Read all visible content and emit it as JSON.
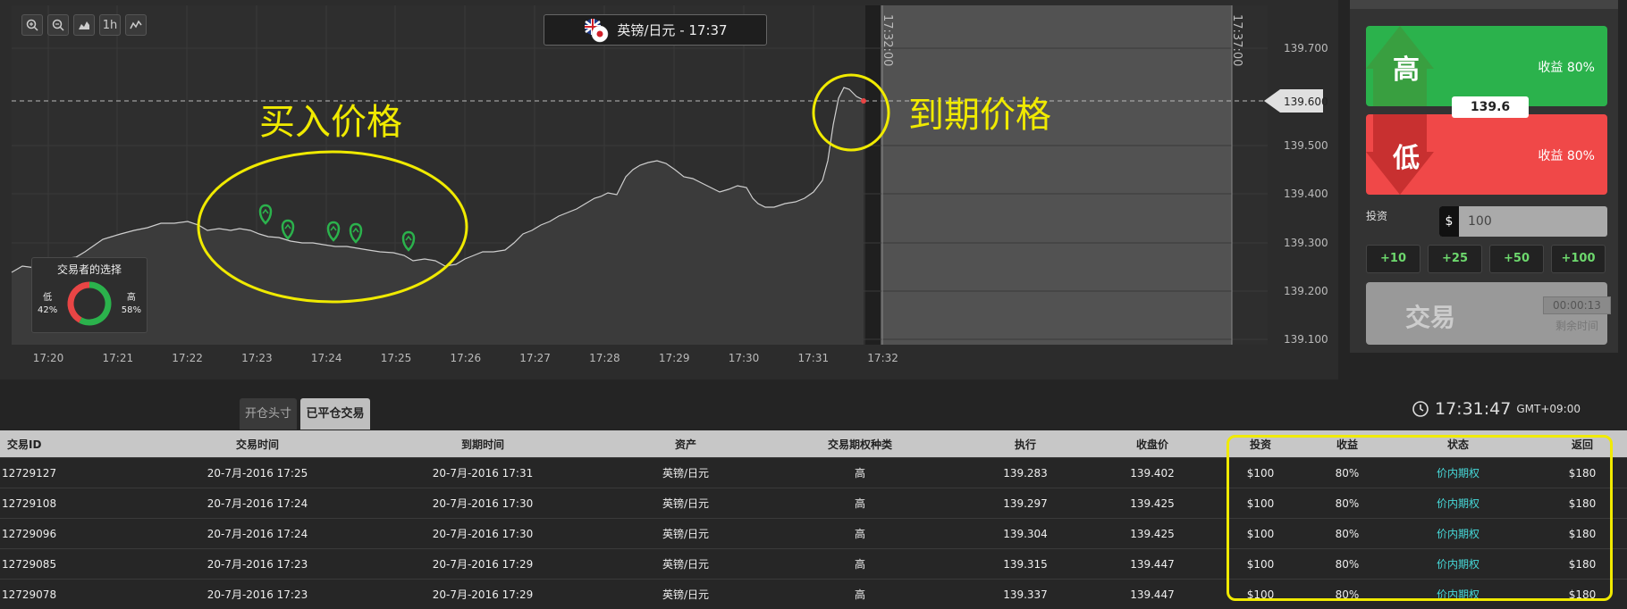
{
  "chart": {
    "asset_label": "英镑/日元 - 17:37",
    "price_levels": [
      "139.700",
      "139.600",
      "139.500",
      "139.400",
      "139.300",
      "139.200",
      "139.100"
    ],
    "current_price_label": "139.600",
    "time_labels": [
      "17:20",
      "17:21",
      "17:22",
      "17:23",
      "17:24",
      "17:25",
      "17:26",
      "17:27",
      "17:28",
      "17:29",
      "17:30",
      "17:31",
      "17:32"
    ],
    "vertical_marker_1": "17:32:00",
    "vertical_marker_2": "17:37:00",
    "annotation_buy": "买入价格",
    "annotation_expiry": "到期价格",
    "toolbar": {
      "zoom_in": "zoom-in",
      "zoom_out": "zoom-out",
      "area": "area-chart",
      "timeframe": "1h",
      "line": "line-chart"
    }
  },
  "trader_choice": {
    "title": "交易者的选择",
    "low_label": "低",
    "low_pct": "42%",
    "high_label": "高",
    "high_pct": "58%",
    "low_fraction": 0.42,
    "high_fraction": 0.58,
    "low_color": "#e84545",
    "high_color": "#2bb24c"
  },
  "trade_panel": {
    "high_label": "高",
    "high_payout": "收益 80%",
    "low_label": "低",
    "low_payout": "收益 80%",
    "current_price": "139.6",
    "invest_label": "投资",
    "currency": "$",
    "invest_value": "100",
    "quick_amounts": [
      "+10",
      "+25",
      "+50",
      "+100"
    ],
    "trade_label": "交易",
    "timer": "00:00:13",
    "remaining_label": "剩余时间",
    "high_color": "#2bb24c",
    "low_color": "#f04848"
  },
  "tabs": {
    "open": "开仓头寸",
    "closed": "已平仓交易"
  },
  "clock": {
    "time": "17:31:47",
    "tz": "GMT+09:00"
  },
  "table": {
    "headers": [
      "交易ID",
      "交易时间",
      "到期时间",
      "资产",
      "交易期权种类",
      "执行",
      "收盘价",
      "投资",
      "收益",
      "状态",
      "返回"
    ],
    "rows": [
      [
        "12729127",
        "20-7月-2016 17:25",
        "20-7月-2016 17:31",
        "英镑/日元",
        "高",
        "139.283",
        "139.402",
        "$100",
        "80%",
        "价内期权",
        "$180"
      ],
      [
        "12729108",
        "20-7月-2016 17:24",
        "20-7月-2016 17:30",
        "英镑/日元",
        "高",
        "139.297",
        "139.425",
        "$100",
        "80%",
        "价内期权",
        "$180"
      ],
      [
        "12729096",
        "20-7月-2016 17:24",
        "20-7月-2016 17:30",
        "英镑/日元",
        "高",
        "139.304",
        "139.425",
        "$100",
        "80%",
        "价内期权",
        "$180"
      ],
      [
        "12729085",
        "20-7月-2016 17:23",
        "20-7月-2016 17:29",
        "英镑/日元",
        "高",
        "139.315",
        "139.447",
        "$100",
        "80%",
        "价内期权",
        "$180"
      ],
      [
        "12729078",
        "20-7月-2016 17:23",
        "20-7月-2016 17:29",
        "英镑/日元",
        "高",
        "139.337",
        "139.447",
        "$100",
        "80%",
        "价内期权",
        "$180"
      ]
    ]
  },
  "colors": {
    "annotation": "#f0ea00",
    "status": "#46d9d9",
    "quick_amount": "#6dd86d"
  }
}
